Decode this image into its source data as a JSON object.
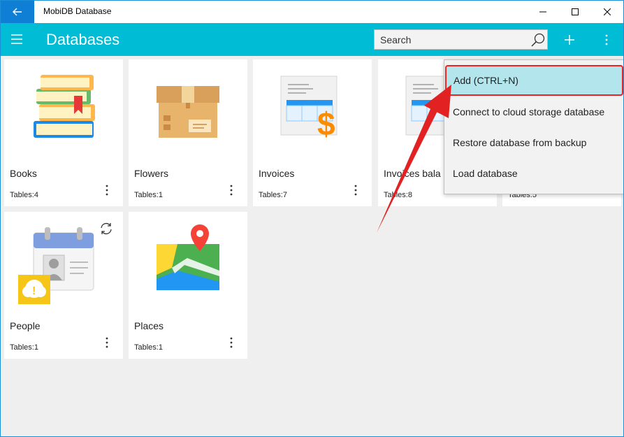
{
  "window": {
    "title": "MobiDB Database"
  },
  "appbar": {
    "title": "Databases",
    "search_placeholder": "Search"
  },
  "databases": [
    {
      "name": "Books",
      "tables": "Tables:4",
      "icon": "books-icon"
    },
    {
      "name": "Flowers",
      "tables": "Tables:1",
      "icon": "box-icon"
    },
    {
      "name": "Invoices",
      "tables": "Tables:7",
      "icon": "invoice-icon"
    },
    {
      "name": "Invoices bala",
      "tables": "Tables:8",
      "icon": "invoice-icon"
    },
    {
      "name": "",
      "tables": "Tables:5",
      "icon": "database-icon"
    },
    {
      "name": "People",
      "tables": "Tables:1",
      "icon": "contact-card-icon"
    },
    {
      "name": "Places",
      "tables": "Tables:1",
      "icon": "map-icon"
    }
  ],
  "menu": {
    "items": [
      {
        "label": "Add (CTRL+N)"
      },
      {
        "label": "Connect to cloud storage database"
      },
      {
        "label": "Restore database from backup"
      },
      {
        "label": "Load database"
      }
    ]
  },
  "colors": {
    "accent": "#00bcd4",
    "titlebar_back": "#0f7fd6",
    "highlight": "#b3e5ec",
    "annotation_red": "#e22222"
  }
}
